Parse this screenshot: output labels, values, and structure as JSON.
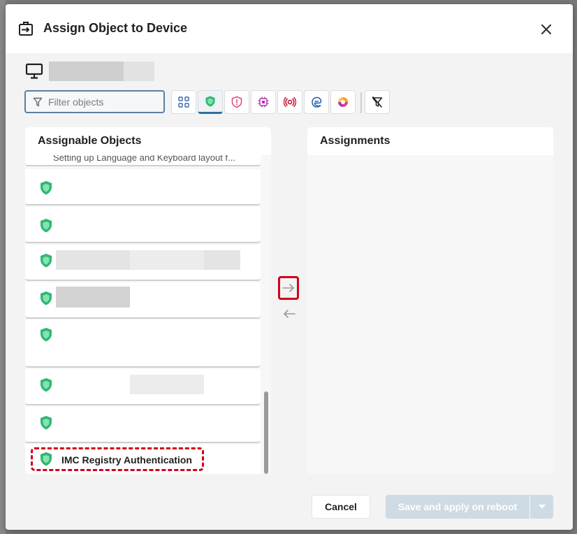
{
  "dialog": {
    "title": "Assign Object to Device",
    "header_icon": "assign-arrow-box-icon",
    "close_icon": "close-icon"
  },
  "device": {
    "icon": "monitor-icon"
  },
  "filter": {
    "placeholder": "Filter objects",
    "icon": "funnel-icon"
  },
  "type_filters": [
    {
      "name": "all-objects",
      "icon": "grid-icon",
      "color": "#3b6fb0",
      "active": false
    },
    {
      "name": "security-objects",
      "icon": "shield-icon",
      "color": "#2eb872",
      "active": true
    },
    {
      "name": "policy-objects",
      "icon": "shield-alert-icon",
      "color": "#e0457b",
      "active": false
    },
    {
      "name": "chip-objects",
      "icon": "chip-icon",
      "color": "#b535a8",
      "active": false
    },
    {
      "name": "network-objects",
      "icon": "signal-icon",
      "color": "#c8102e",
      "active": false
    },
    {
      "name": "app-objects",
      "icon": "edge-icon",
      "color": "#1a5fa8",
      "active": false
    },
    {
      "name": "palette-objects",
      "icon": "palette-icon",
      "color": "#f2a11f",
      "active": false
    }
  ],
  "clear_filters_icon": "filter-clear-icon",
  "assignable": {
    "title": "Assignable Objects",
    "cut_item_text": "Setting up Language and Keyboard layout f...",
    "highlighted_item_label": "IMC Registry Authentication"
  },
  "assignments": {
    "title": "Assignments"
  },
  "move_icons": {
    "assign": "arrow-right-icon",
    "unassign": "arrow-left-icon"
  },
  "footer": {
    "cancel_label": "Cancel",
    "save_label": "Save and apply on reboot",
    "dropdown_icon": "caret-down-icon"
  },
  "colors": {
    "accent": "#2f6fa0",
    "shield": "#2eb872",
    "highlight": "#d0021b"
  }
}
